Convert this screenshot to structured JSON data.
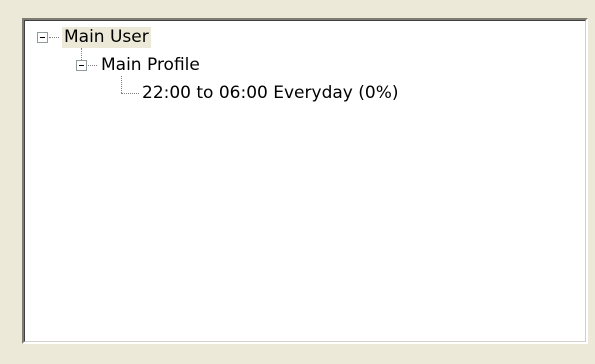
{
  "tree": {
    "root": {
      "label": "Main User",
      "expanded": true,
      "expander_icon": "minus-expander-icon",
      "children": [
        {
          "label": "Main Profile",
          "expanded": true,
          "expander_icon": "minus-expander-icon",
          "children": [
            {
              "label": "22:00 to 06:00 Everyday (0%)"
            }
          ]
        }
      ]
    }
  },
  "colors": {
    "window_background": "#ece9d8",
    "tree_background": "#ffffff",
    "selection_highlight": "#ece9d8",
    "connector_line": "#808080"
  }
}
